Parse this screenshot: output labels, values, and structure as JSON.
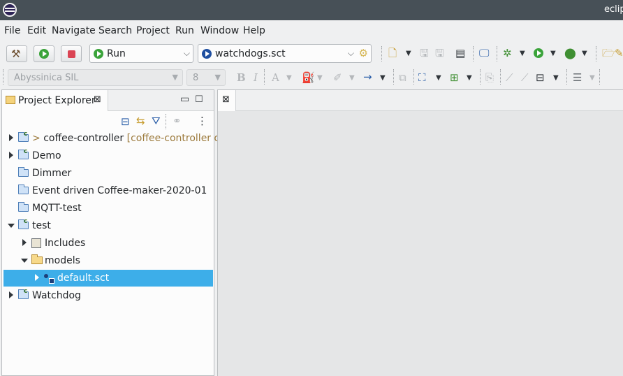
{
  "window": {
    "title": "eclip"
  },
  "menu": [
    "File",
    "Edit",
    "Navigate",
    "Search",
    "Project",
    "Run",
    "Window",
    "Help"
  ],
  "toolbar": {
    "run_config": "Run",
    "launch_target": "watchdogs.sct"
  },
  "format_toolbar": {
    "font": "Abyssinica SIL",
    "font_size": "8",
    "bold": "B",
    "italic": "I",
    "font_color": "A"
  },
  "explorer": {
    "title": "Project Explorer",
    "tree": [
      {
        "prefix": "> ",
        "label": "coffee-controller",
        "decoration": " [coffee-controller deve",
        "type": "project",
        "state": "collapsed",
        "level": 0
      },
      {
        "label": "Demo",
        "type": "project",
        "state": "collapsed",
        "level": 0
      },
      {
        "label": "Dimmer",
        "type": "closed-project",
        "state": "none",
        "level": 0
      },
      {
        "label": "Event driven Coffee-maker-2020-01",
        "type": "closed-project",
        "state": "none",
        "level": 0
      },
      {
        "label": "MQTT-test",
        "type": "closed-project",
        "state": "none",
        "level": 0
      },
      {
        "label": "test",
        "type": "project",
        "state": "expanded",
        "level": 0
      },
      {
        "label": "Includes",
        "type": "includes",
        "state": "collapsed",
        "level": 1
      },
      {
        "label": "models",
        "type": "folder",
        "state": "expanded",
        "level": 1
      },
      {
        "label": "default.sct",
        "type": "sct-file",
        "state": "collapsed",
        "level": 2,
        "selected": true
      },
      {
        "label": "Watchdog",
        "type": "project",
        "state": "collapsed",
        "level": 0
      }
    ]
  },
  "colors": {
    "titlebar": "#475057",
    "selection": "#3daee9",
    "panel_bg": "#eff0f1"
  }
}
